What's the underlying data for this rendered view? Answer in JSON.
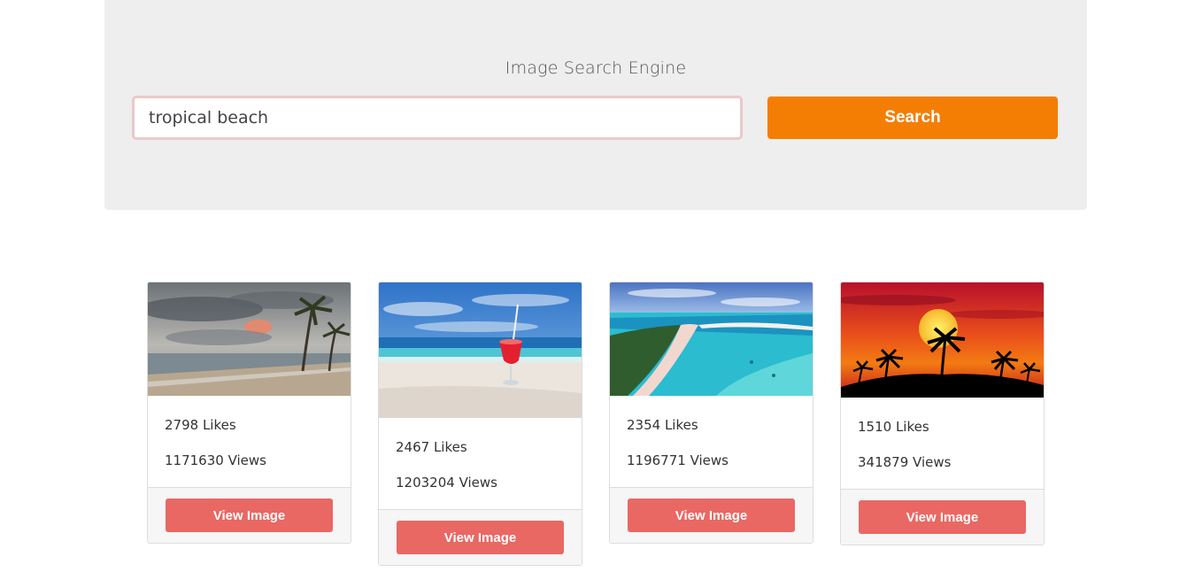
{
  "header": {
    "title": "Image Search Engine",
    "search_value": "tropical beach",
    "search_button_label": "Search"
  },
  "results": [
    {
      "likes": "2798 Likes",
      "views": "1171630 Views",
      "button_label": "View Image",
      "image": "beach-palms-cloudy-sunset"
    },
    {
      "likes": "2467 Likes",
      "views": "1203204 Views",
      "button_label": "View Image",
      "image": "red-cocktail-on-beach"
    },
    {
      "likes": "2354 Likes",
      "views": "1196771 Views",
      "button_label": "View Image",
      "image": "aerial-turquoise-lagoon"
    },
    {
      "likes": "1510 Likes",
      "views": "341879 Views",
      "button_label": "View Image",
      "image": "palm-silhouette-red-sunset"
    }
  ],
  "colors": {
    "search_button": "#f47e03",
    "view_button": "#e96863",
    "jumbotron_bg": "#edeeed"
  }
}
